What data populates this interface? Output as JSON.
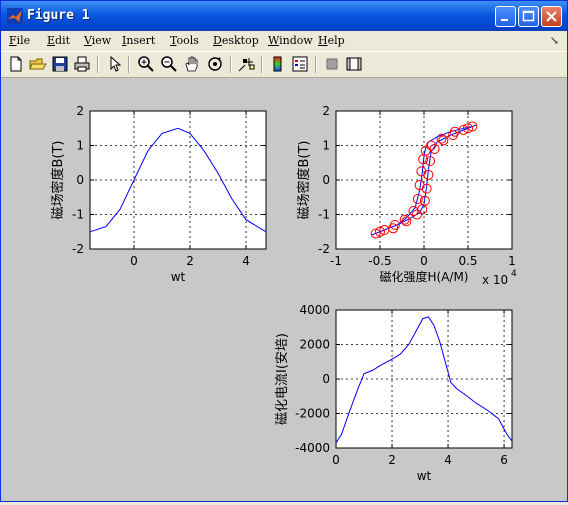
{
  "window": {
    "title": "Figure 1"
  },
  "menu": [
    "File",
    "Edit",
    "View",
    "Insert",
    "Tools",
    "Desktop",
    "Window",
    "Help"
  ],
  "menu_arrow": "↘",
  "toolbar": [
    "new-icon",
    "open-icon",
    "save-icon",
    "print-icon",
    "select-arrow-icon",
    "zoom-in-icon",
    "zoom-out-icon",
    "pan-hand-icon",
    "rotate-3d-icon",
    "data-cursor-icon",
    "colorbar-icon",
    "legend-icon",
    "hide-plot-tools-icon",
    "show-plot-tools-icon"
  ],
  "chart_data": [
    {
      "type": "line",
      "title": "",
      "xlabel": "wt",
      "ylabel": "磁场密度B(T)",
      "xlim": [
        -1.5708,
        4.7124
      ],
      "ylim": [
        -2,
        2
      ],
      "xticks": [
        "0",
        "2",
        "4"
      ],
      "yticks": [
        "-2",
        "-1",
        "0",
        "1",
        "2"
      ],
      "grid": true,
      "series": [
        {
          "color": "#0000ff",
          "x": [
            -1.5708,
            -1.0,
            -0.5,
            0,
            0.5,
            1.0,
            1.5708,
            2.0,
            2.5,
            3.0,
            3.5,
            4.0,
            4.7124
          ],
          "y": [
            -1.5,
            -1.35,
            -0.85,
            0,
            0.85,
            1.35,
            1.5,
            1.35,
            0.85,
            0.2,
            -0.55,
            -1.15,
            -1.5
          ]
        }
      ]
    },
    {
      "type": "line",
      "title": "",
      "xlabel": "磁化强度H(A/M)",
      "xexponent": "x 10",
      "xexponent_power": "4",
      "ylabel": "磁场密度B(T)",
      "xlim": [
        -1,
        1
      ],
      "ylim": [
        -2,
        2
      ],
      "xticks": [
        "-1",
        "-0.5",
        "0",
        "0.5",
        "1"
      ],
      "yticks": [
        "-2",
        "-1",
        "0",
        "1",
        "2"
      ],
      "grid": true,
      "series": [
        {
          "color": "#0000ff",
          "x": [
            -0.6,
            -0.45,
            -0.3,
            -0.2,
            -0.1,
            -0.05,
            -0.02,
            0.0,
            0.02,
            0.05,
            0.15,
            0.3,
            0.45,
            0.55,
            0.6,
            0.45,
            0.3,
            0.15,
            0.08,
            0.05,
            0.03,
            0.0,
            -0.05,
            -0.15,
            -0.3,
            -0.45,
            -0.6
          ],
          "y": [
            -1.6,
            -1.45,
            -1.3,
            -1.1,
            -0.8,
            -0.3,
            0.2,
            0.7,
            0.95,
            1.1,
            1.25,
            1.4,
            1.5,
            1.55,
            1.6,
            1.45,
            1.3,
            1.1,
            0.8,
            0.3,
            -0.2,
            -0.7,
            -0.95,
            -1.1,
            -1.3,
            -1.45,
            -1.6
          ]
        },
        {
          "color": "#ff0000",
          "marker": "o",
          "x": [
            -0.55,
            -0.45,
            -0.33,
            -0.22,
            -0.12,
            -0.07,
            -0.05,
            -0.03,
            -0.01,
            0.02,
            0.08,
            0.2,
            0.35,
            0.5,
            0.55,
            0.45,
            0.33,
            0.22,
            0.12,
            0.07,
            0.05,
            0.03,
            0.01,
            -0.02,
            -0.08,
            -0.2,
            -0.35,
            -0.5
          ],
          "y": [
            -1.55,
            -1.45,
            -1.3,
            -1.15,
            -0.9,
            -0.55,
            -0.15,
            0.25,
            0.6,
            0.85,
            1.0,
            1.2,
            1.4,
            1.5,
            1.55,
            1.45,
            1.3,
            1.15,
            0.9,
            0.55,
            0.15,
            -0.25,
            -0.6,
            -0.85,
            -1.0,
            -1.2,
            -1.4,
            -1.5
          ]
        }
      ]
    },
    {
      "type": "line",
      "title": "",
      "xlabel": "wt",
      "ylabel": "磁化电流I(安培)",
      "xlim": [
        0,
        6.2832
      ],
      "ylim": [
        -4000,
        4000
      ],
      "xticks": [
        "0",
        "2",
        "4",
        "6"
      ],
      "yticks": [
        "-4000",
        "-2000",
        "0",
        "2000",
        "4000"
      ],
      "grid": true,
      "series": [
        {
          "color": "#0000ff",
          "x": [
            0,
            0.2,
            0.5,
            0.8,
            1.0,
            1.3,
            1.6,
            2.0,
            2.3,
            2.6,
            2.9,
            3.1,
            3.3,
            3.5,
            3.7,
            3.9,
            4.1,
            4.3,
            4.6,
            5.0,
            5.4,
            5.8,
            6.1,
            6.2832
          ],
          "y": [
            -3700,
            -3200,
            -1800,
            -500,
            300,
            500,
            800,
            1150,
            1450,
            2000,
            2900,
            3500,
            3600,
            3100,
            2200,
            1000,
            -200,
            -550,
            -900,
            -1400,
            -1800,
            -2300,
            -3200,
            -3600
          ]
        }
      ]
    }
  ]
}
